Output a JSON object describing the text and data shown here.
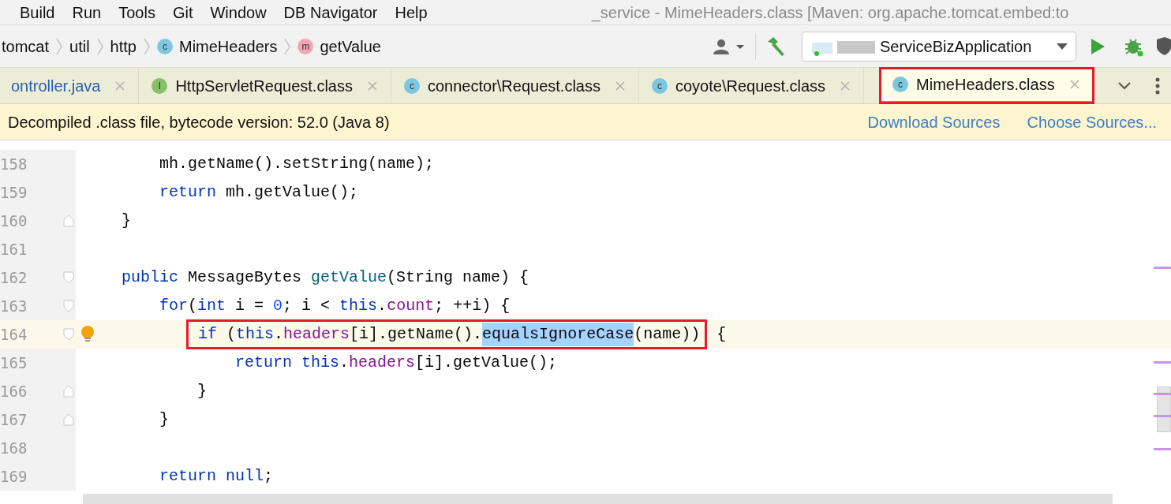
{
  "menu": [
    "Build",
    "Run",
    "Tools",
    "Git",
    "Window",
    "DB Navigator",
    "Help"
  ],
  "window_title": "_service - MimeHeaders.class [Maven: org.apache.tomcat.embed:to",
  "breadcrumb": [
    {
      "text": "tomcat"
    },
    {
      "text": "util"
    },
    {
      "text": "http"
    },
    {
      "text": "MimeHeaders",
      "icon": {
        "kind": "class",
        "letter": "c"
      }
    },
    {
      "text": "getValue",
      "icon": {
        "kind": "method",
        "letter": "m"
      }
    }
  ],
  "run_config": "ServiceBizApplication",
  "tabs": [
    {
      "label": "ontroller.java",
      "selected": false,
      "boxed": false
    },
    {
      "label": "HttpServletRequest.class",
      "selected": false,
      "boxed": false,
      "icon": {
        "kind": "interface",
        "letter": "I"
      }
    },
    {
      "label": "connector\\Request.class",
      "selected": false,
      "boxed": false,
      "icon": {
        "kind": "class",
        "letter": "c"
      }
    },
    {
      "label": "coyote\\Request.class",
      "selected": false,
      "boxed": false,
      "icon": {
        "kind": "class",
        "letter": "c"
      }
    },
    {
      "label": "MimeHeaders.class",
      "selected": true,
      "boxed": true,
      "icon": {
        "kind": "class",
        "letter": "c"
      }
    }
  ],
  "banner": {
    "text": "Decompiled .class file, bytecode version: 52.0 (Java 8)",
    "links": [
      "Download Sources",
      "Choose Sources..."
    ]
  },
  "code": [
    {
      "number": "158",
      "tokens": [
        {
          "kind": "plain",
          "text": "    mh.getName().setString(name);"
        }
      ]
    },
    {
      "number": "159",
      "tokens": [
        {
          "kind": "keyword",
          "text": "    return"
        },
        {
          "kind": "plain",
          "text": " mh.getValue();"
        }
      ]
    },
    {
      "number": "160",
      "fold_end": true,
      "tokens": [
        {
          "kind": "plain",
          "text": "}"
        }
      ]
    },
    {
      "number": "161"
    },
    {
      "number": "162",
      "fold_start": true,
      "tokens": [
        {
          "kind": "keyword",
          "text": "public"
        },
        {
          "kind": "plain",
          "text": " MessageBytes "
        },
        {
          "kind": "declaration",
          "text": "getValue"
        },
        {
          "kind": "plain",
          "text": "(String name) {"
        }
      ]
    },
    {
      "number": "163",
      "fold_start": true,
      "tokens": [
        {
          "kind": "keyword",
          "text": "    for"
        },
        {
          "kind": "plain",
          "text": "("
        },
        {
          "kind": "keyword",
          "text": "int"
        },
        {
          "kind": "plain",
          "text": " i = "
        },
        {
          "kind": "number",
          "text": "0"
        },
        {
          "kind": "plain",
          "text": "; i < "
        },
        {
          "kind": "keyword",
          "text": "this"
        },
        {
          "kind": "plain",
          "text": "."
        },
        {
          "kind": "field",
          "text": "count"
        },
        {
          "kind": "plain",
          "text": "; ++i) {"
        }
      ]
    },
    {
      "number": "164",
      "current": true,
      "bulb": true,
      "fold_start": true,
      "boxed": [
        {
          "kind": "keyword",
          "text": "if"
        },
        {
          "kind": "plain",
          "text": " ("
        },
        {
          "kind": "keyword",
          "text": "this"
        },
        {
          "kind": "plain",
          "text": "."
        },
        {
          "kind": "field",
          "text": "headers"
        },
        {
          "kind": "plain",
          "text": "[i].getName()."
        },
        {
          "kind": "selected",
          "text": "equalsIgnoreCase"
        },
        {
          "kind": "plain",
          "text": "(name))"
        }
      ],
      "after": [
        {
          "kind": "plain",
          "text": " {"
        }
      ]
    },
    {
      "number": "165",
      "tokens": [
        {
          "kind": "keyword",
          "text": "            return this"
        },
        {
          "kind": "plain",
          "text": "."
        },
        {
          "kind": "field",
          "text": "headers"
        },
        {
          "kind": "plain",
          "text": "[i].getValue();"
        }
      ]
    },
    {
      "number": "166",
      "fold_end": true,
      "tokens": [
        {
          "kind": "plain",
          "text": "        }"
        }
      ]
    },
    {
      "number": "167",
      "fold_end": true,
      "tokens": [
        {
          "kind": "plain",
          "text": "    }"
        }
      ]
    },
    {
      "number": "168"
    },
    {
      "number": "169",
      "tokens": [
        {
          "kind": "keyword",
          "text": "    return null"
        },
        {
          "kind": "plain",
          "text": ";"
        }
      ]
    }
  ]
}
